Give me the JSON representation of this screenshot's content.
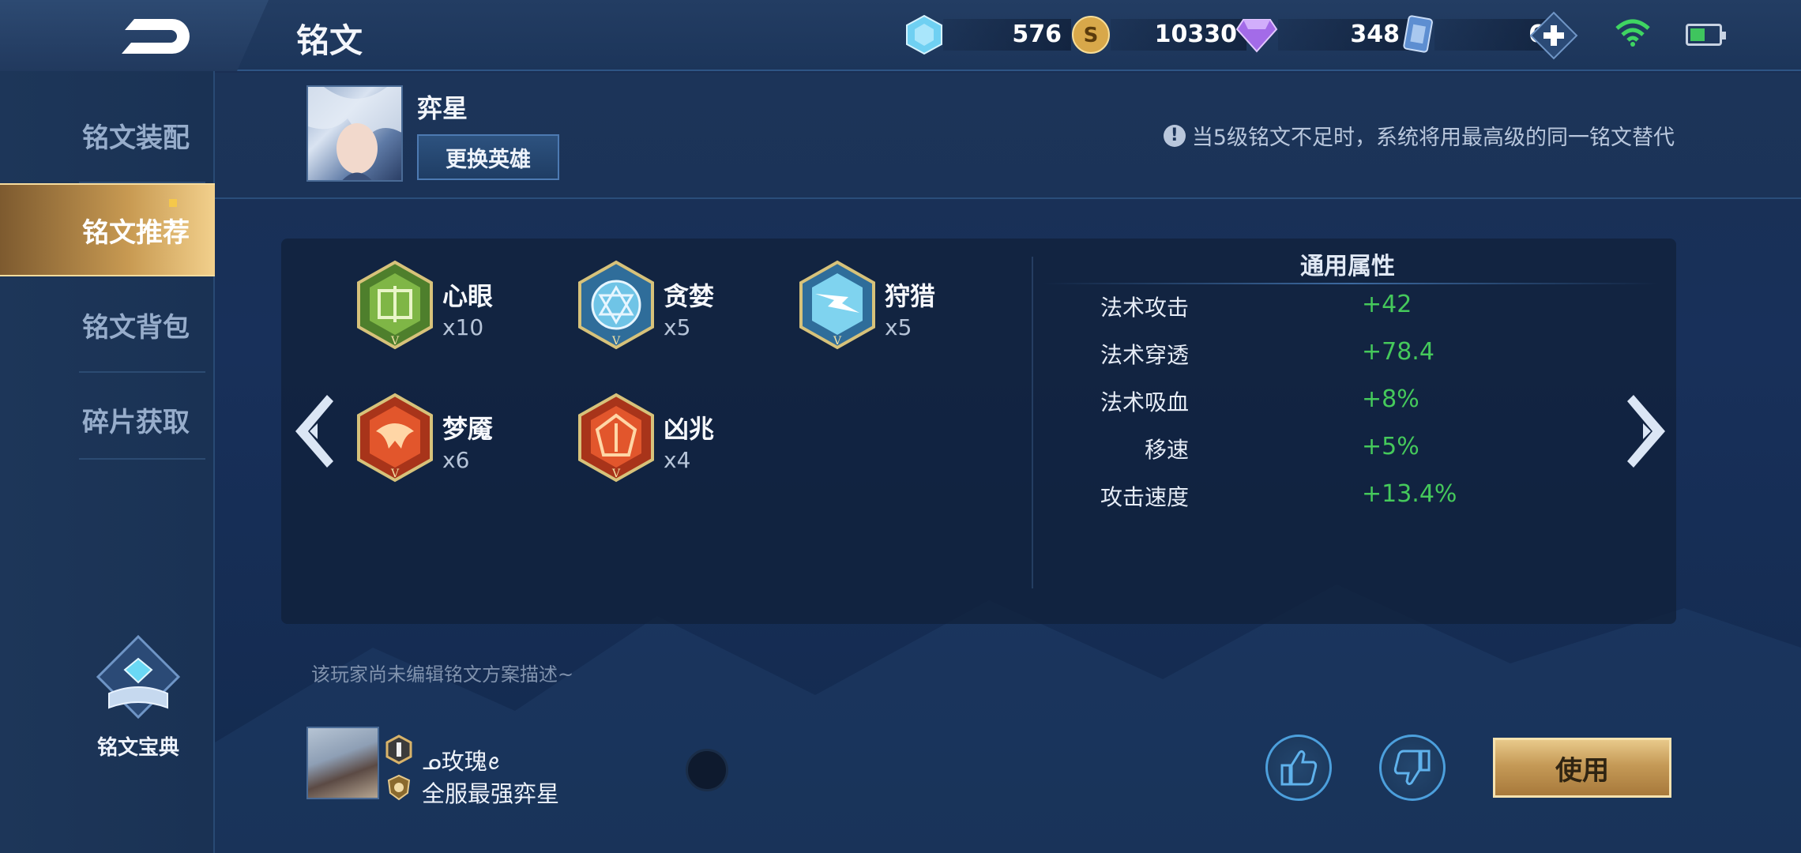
{
  "header": {
    "title": "铭文",
    "currencies": [
      {
        "icon": "diamond-coupon-icon",
        "amount": "576"
      },
      {
        "icon": "gold-coin-icon",
        "amount": "10330"
      },
      {
        "icon": "purple-gem-icon",
        "amount": "348"
      },
      {
        "icon": "rune-card-icon",
        "amount": "6"
      }
    ]
  },
  "sidebar": {
    "items": [
      {
        "label": "铭文装配"
      },
      {
        "label": "铭文推荐"
      },
      {
        "label": "铭文背包"
      },
      {
        "label": "碎片获取"
      }
    ],
    "book_label": "铭文宝典"
  },
  "hero": {
    "name": "弈星",
    "change_label": "更换英雄",
    "notice": "当5级铭文不足时，系统将用最高级的同一铭文替代"
  },
  "runes": [
    {
      "name": "心眼",
      "count": "x10",
      "color": "green"
    },
    {
      "name": "贪婪",
      "count": "x5",
      "color": "blue"
    },
    {
      "name": "狩猎",
      "count": "x5",
      "color": "blue"
    },
    {
      "name": "梦魇",
      "count": "x6",
      "color": "red"
    },
    {
      "name": "凶兆",
      "count": "x4",
      "color": "red"
    }
  ],
  "attributes": {
    "title": "通用属性",
    "rows": [
      {
        "key": "法术攻击",
        "value": "+42"
      },
      {
        "key": "法术穿透",
        "value": "+78.4"
      },
      {
        "key": "法术吸血",
        "value": "+8%"
      },
      {
        "key": "移速",
        "value": "+5%"
      },
      {
        "key": "攻击速度",
        "value": "+13.4%"
      }
    ]
  },
  "description": "该玩家尚未编辑铭文方案描述~",
  "player": {
    "name": "ᓄ玫瑰ꫀ",
    "title": "全服最强弈星"
  },
  "actions": {
    "use_label": "使用"
  },
  "colors": {
    "accent_gold": "#c89a52",
    "value_green": "#45c95b",
    "bg_blue": "#18305a"
  }
}
